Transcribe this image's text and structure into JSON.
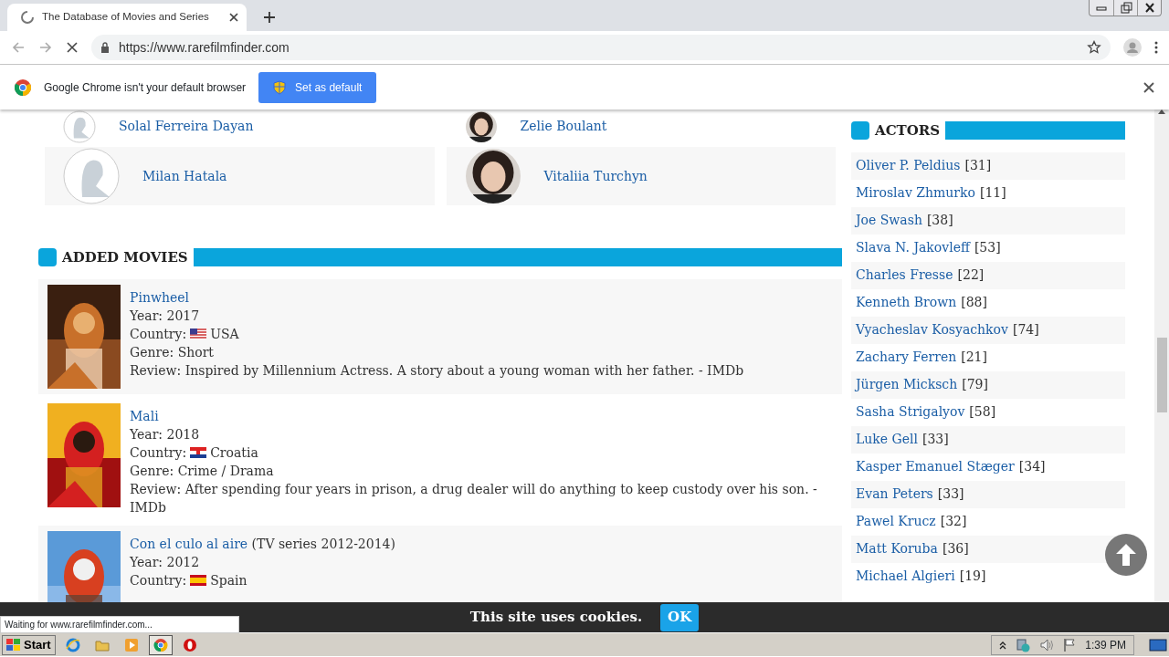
{
  "browser": {
    "tab": {
      "title": "The Database of Movies and Series",
      "loading": true
    },
    "url": "https://www.rarefilmfinder.com",
    "infobar": {
      "message": "Google Chrome isn't your default browser",
      "button": "Set as default"
    }
  },
  "people": [
    {
      "name": "Solal Ferreira Dayan",
      "kind": "silhouette"
    },
    {
      "name": "Zelie Boulant"
    },
    {
      "name": "Milan Hatala",
      "kind": "silhouette"
    },
    {
      "name": "Vitaliia Turchyn"
    }
  ],
  "added_movies": {
    "heading": "ADDED MOVIES",
    "items": [
      {
        "title": "Pinwheel",
        "year": "Year: 2017",
        "country_label": "Country:",
        "country": "USA",
        "flag": {
          "kind": "us"
        },
        "genre": "Genre: Short",
        "review": "Review: Inspired by Millennium Actress. A story about a young woman with her father. - IMDb"
      },
      {
        "title": "Mali",
        "year": "Year: 2018",
        "country_label": "Country:",
        "country": "Croatia",
        "flag": {
          "kind": "hr"
        },
        "genre": "Genre: Crime / Drama",
        "review": "Review: After spending four years in prison, a drug dealer will do anything to keep custody over his son. - IMDb"
      },
      {
        "title": "Con el culo al aire",
        "extra": "(TV series 2012-2014)",
        "year": "Year: 2012",
        "country_label": "Country:",
        "country": "Spain",
        "flag": {
          "kind": "es"
        }
      }
    ]
  },
  "actors": {
    "heading": "ACTORS",
    "items": [
      {
        "name": "Oliver P. Peldius",
        "count": "[31]"
      },
      {
        "name": "Miroslav Zhmurko",
        "count": "[11]"
      },
      {
        "name": "Joe Swash",
        "count": "[38]"
      },
      {
        "name": "Slava N. Jakovleff",
        "count": "[53]"
      },
      {
        "name": "Charles Fresse",
        "count": "[22]"
      },
      {
        "name": "Kenneth Brown",
        "count": "[88]"
      },
      {
        "name": "Vyacheslav Kosyachkov",
        "count": "[74]"
      },
      {
        "name": "Zachary Ferren",
        "count": "[21]"
      },
      {
        "name": "Jürgen Micksch",
        "count": "[79]"
      },
      {
        "name": "Sasha Strigalyov",
        "count": "[58]"
      },
      {
        "name": "Luke Gell",
        "count": "[33]"
      },
      {
        "name": "Kasper Emanuel Stæger",
        "count": "[34]"
      },
      {
        "name": "Evan Peters",
        "count": "[33]"
      },
      {
        "name": "Pawel Krucz",
        "count": "[32]"
      },
      {
        "name": "Matt Koruba",
        "count": "[36]"
      },
      {
        "name": "Michael Algieri",
        "count": "[19]"
      }
    ]
  },
  "cookie_bar": {
    "message": "This site uses cookies.",
    "button": "OK"
  },
  "status": "Waiting for www.rarefilmfinder.com...",
  "taskbar": {
    "start": "Start",
    "apps": [
      {
        "kind": "ie",
        "active": false
      },
      {
        "kind": "folder",
        "active": false
      },
      {
        "kind": "media",
        "active": false
      },
      {
        "kind": "chrome",
        "active": true
      },
      {
        "kind": "opera",
        "active": false
      }
    ],
    "clock": "1:39 PM"
  }
}
